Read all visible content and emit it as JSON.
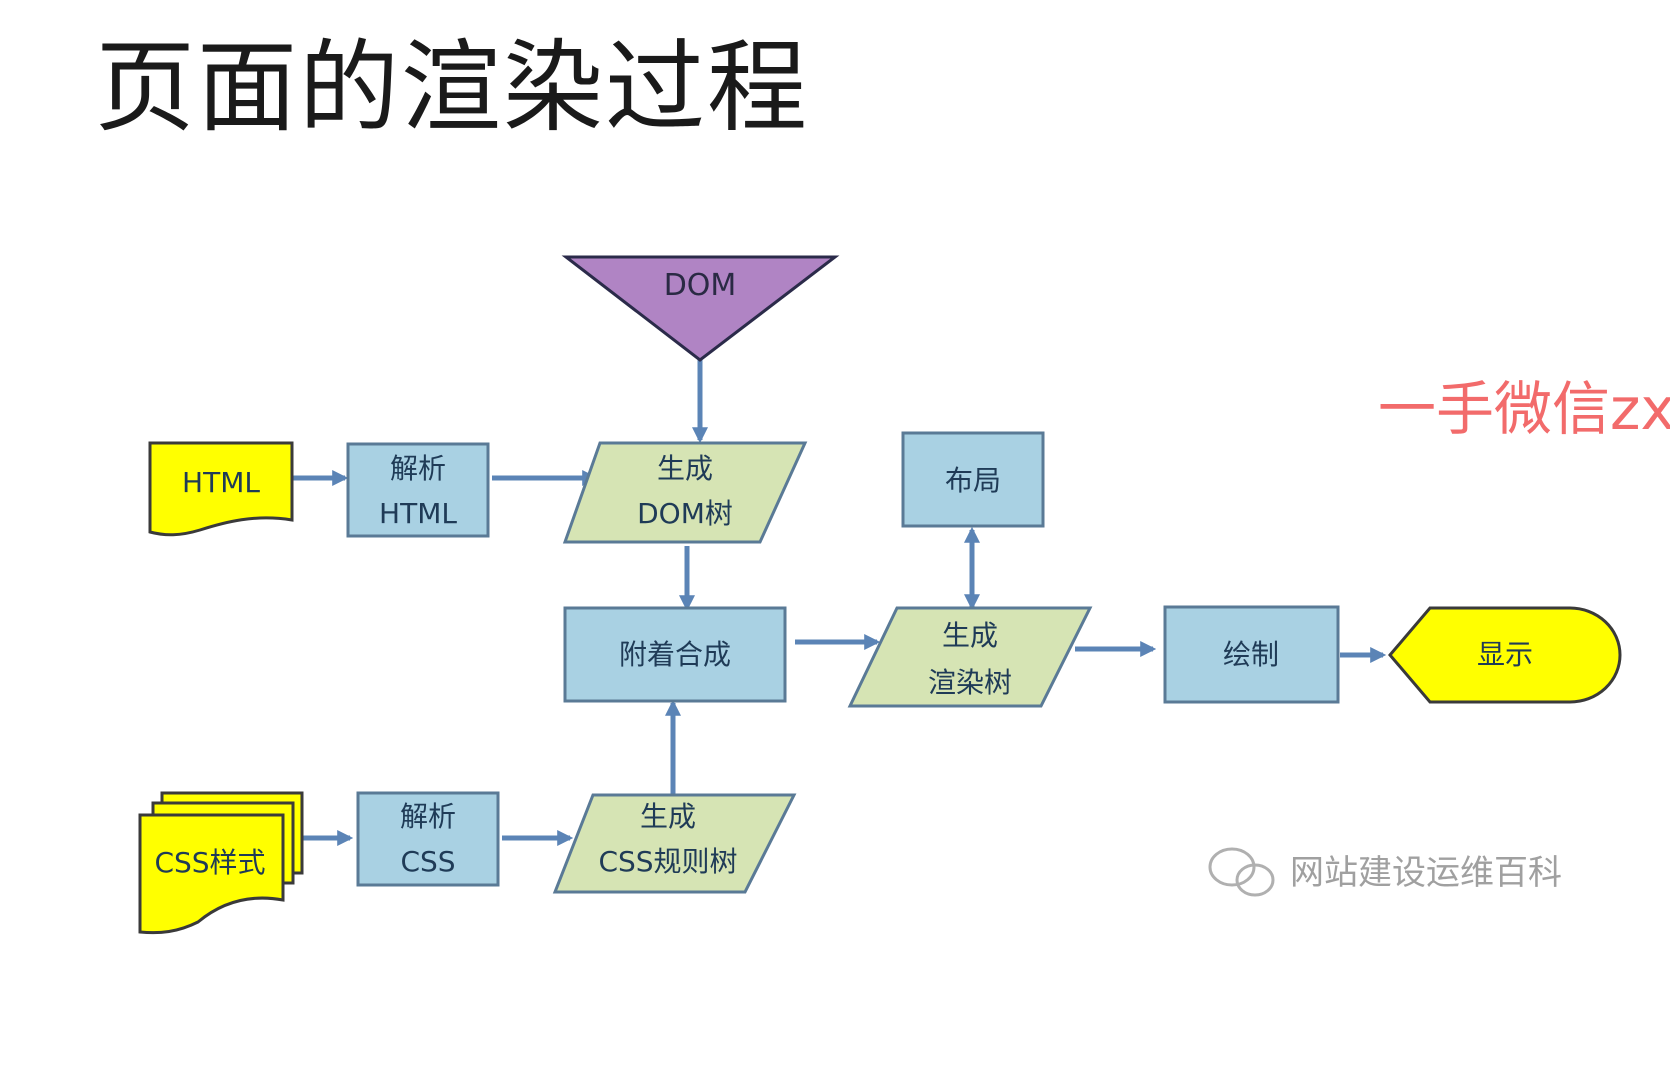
{
  "title": "页面的渲染过程",
  "watermark_top": "一手微信zx",
  "watermark_bottom": "网站建设运维百科",
  "nodes": {
    "dom": "DOM",
    "html_doc": "HTML",
    "parse_html": [
      "解析",
      "HTML"
    ],
    "gen_dom_tree": [
      "生成",
      "DOM树"
    ],
    "attach": "附着合成",
    "css_doc": "CSS样式",
    "parse_css": [
      "解析",
      "CSS"
    ],
    "gen_css_tree": [
      "生成",
      "CSS规则树"
    ],
    "layout": "布局",
    "gen_render_tree": [
      "生成",
      "渲染树"
    ],
    "paint": "绘制",
    "display": "显示"
  },
  "colors": {
    "doc_fill": "#ffff00",
    "process_fill": "#a9d1e3",
    "data_fill": "#d6e4b4",
    "dom_fill": "#b084c4",
    "stroke": "#5a7a96",
    "arrow": "#5b84b6"
  }
}
